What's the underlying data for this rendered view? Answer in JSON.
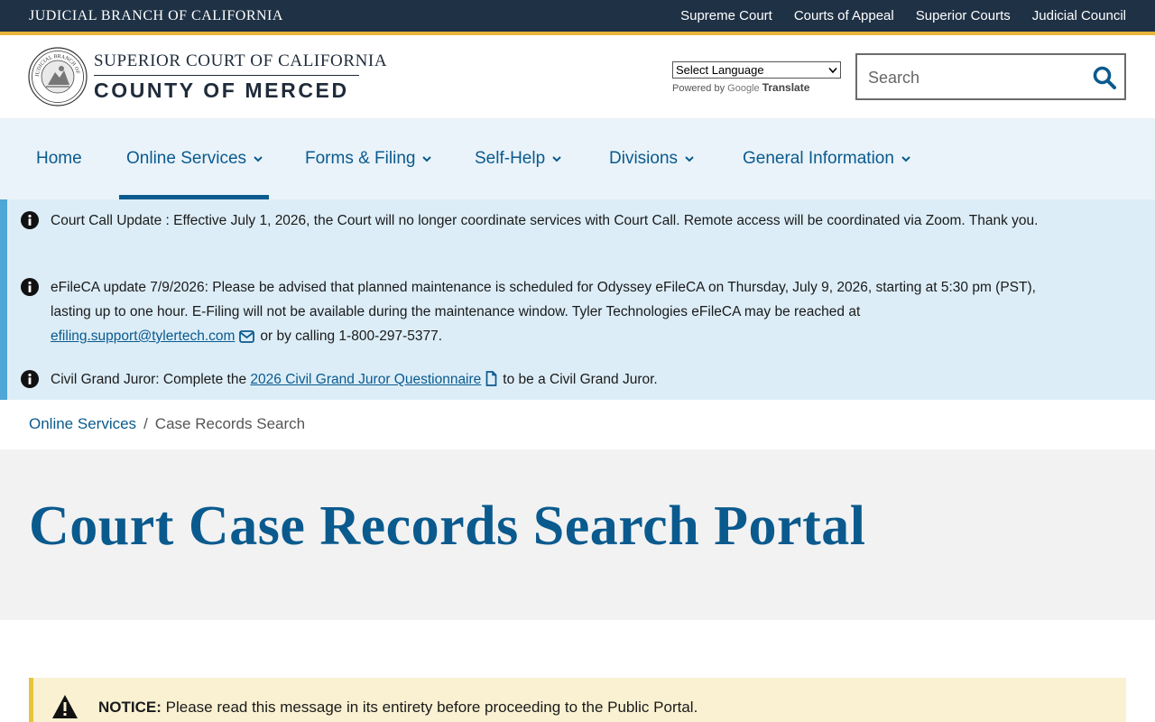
{
  "topbar": {
    "branch": "JUDICIAL BRANCH OF CALIFORNIA",
    "links": [
      "Supreme Court",
      "Courts of Appeal",
      "Superior Courts",
      "Judicial Council"
    ]
  },
  "header": {
    "court_line1": "SUPERIOR COURT OF CALIFORNIA",
    "court_line2": "COUNTY OF MERCED",
    "seal_text": "JUDICIAL BRANCH OF CALIFORNIA",
    "language_select": "Select Language",
    "powered_by": "Powered by",
    "google": "Google",
    "translate": "Translate",
    "search_placeholder": "Search"
  },
  "nav": {
    "items": [
      {
        "label": "Home"
      },
      {
        "label": "Online Services"
      },
      {
        "label": "Forms & Filing"
      },
      {
        "label": "Self-Help"
      },
      {
        "label": "Divisions"
      },
      {
        "label": "General Information"
      }
    ]
  },
  "alerts": {
    "a1": "Court Call Update : Effective July 1, 2026, the Court will no longer coordinate services with Court Call. Remote access will be coordinated via Zoom. Thank you.",
    "a2_text": "eFileCA update 7/9/2026: Please be advised that planned maintenance is scheduled for Odyssey eFileCA on Thursday, July 9, 2026, starting at 5:30 pm (PST), lasting up to one hour. E-Filing will not be available during the maintenance window. Tyler Technologies eFileCA may be reached at",
    "a2_link": "efiling.support@tylertech.com",
    "a2_tail": "or by calling 1-800-297-5377.",
    "a3_text": "Civil Grand Juror: Complete the",
    "a3_link": "2026 Civil Grand Juror Questionnaire",
    "a3_tail": "to be a Civil Grand Juror."
  },
  "breadcrumb": {
    "parent": "Online Services",
    "separator": "/",
    "current": "Case Records Search"
  },
  "page": {
    "title": "Court Case Records Search Portal"
  },
  "notice": {
    "label": "NOTICE:",
    "text": "Please read this message in its entirety before proceeding to the Public Portal."
  }
}
